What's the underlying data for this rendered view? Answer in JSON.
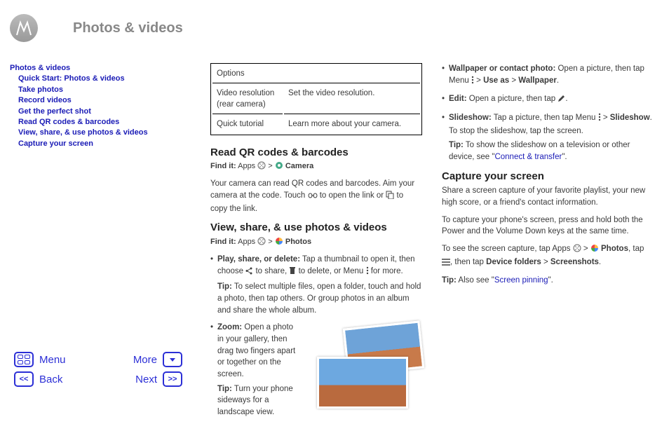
{
  "page_title": "Photos & videos",
  "sidebar": {
    "root": "Photos & videos",
    "items": [
      "Quick Start: Photos & videos",
      "Take photos",
      "Record videos",
      "Get the perfect shot",
      "Read QR codes & barcodes",
      "View, share, & use photos & videos",
      "Capture your screen"
    ]
  },
  "options": {
    "header": "Options",
    "rows": [
      {
        "label": "Video resolution (rear camera)",
        "desc": "Set the video resolution."
      },
      {
        "label": "Quick tutorial",
        "desc": "Learn more about your camera."
      }
    ]
  },
  "qr": {
    "heading": "Read QR codes & barcodes",
    "findit_prefix": "Find it:",
    "findit_apps": "Apps",
    "findit_target": "Camera",
    "body1": "Your camera can read QR codes and barcodes. Aim your camera at the code. Touch ",
    "body2": " to open the link or ",
    "body3": " to copy the link."
  },
  "view": {
    "heading": "View, share, & use photos & videos",
    "findit_prefix": "Find it:",
    "findit_apps": "Apps",
    "findit_target": "Photos",
    "b1_label": "Play, share, or delete:",
    "b1_text1": " Tap a thumbnail to open it, then choose ",
    "b1_text2": " to share, ",
    "b1_text3": " to delete, or Menu ",
    "b1_text4": " for more.",
    "b1_tip_label": "Tip:",
    "b1_tip": " To select multiple files, open a folder, touch and hold a photo, then tap others. Or group photos in an album and share the whole album.",
    "b2_label": "Zoom:",
    "b2_text": " Open a photo in your gallery, then drag two fingers apart or together on the screen.",
    "b2_tip_label": "Tip:",
    "b2_tip": " Turn your phone sideways for a landscape view."
  },
  "col2": {
    "wallpaper_label": "Wallpaper or contact photo:",
    "wallpaper_text1": " Open a picture, then tap Menu ",
    "wallpaper_text2": " > ",
    "wallpaper_use": "Use as",
    "wallpaper_text3": " > ",
    "wallpaper_wp": "Wallpaper",
    "wallpaper_text4": ".",
    "edit_label": "Edit:",
    "edit_text1": " Open a picture, then tap ",
    "edit_text2": ".",
    "slideshow_label": "Slideshow:",
    "slideshow_text1": " Tap a picture, then tap Menu ",
    "slideshow_text2": " > ",
    "slideshow_target": "Slideshow",
    "slideshow_text3": ". To stop the slideshow, tap the screen.",
    "slideshow_tip_label": "Tip:",
    "slideshow_tip1": " To show the slideshow on a television or other device, see \"",
    "slideshow_tip_link": "Connect & transfer",
    "slideshow_tip2": "\"."
  },
  "capture": {
    "heading": "Capture your screen",
    "p1": "Share a screen capture of your favorite playlist, your new high score, or a friend's contact information.",
    "p2": "To capture your phone's screen, press and hold both the Power and the Volume Down keys at the same time.",
    "p3a": "To see the screen capture, tap Apps ",
    "p3b": " > ",
    "p3_photos": "Photos",
    "p3c": ", tap ",
    "p3d": ", then tap ",
    "p3_device": "Device folders",
    "p3e": " > ",
    "p3_screenshots": "Screenshots",
    "p3f": ".",
    "tip_label": "Tip:",
    "tip1": " Also see \"",
    "tip_link": "Screen pinning",
    "tip2": "\"."
  },
  "nav": {
    "menu": "Menu",
    "more": "More",
    "back": "Back",
    "next": "Next"
  }
}
